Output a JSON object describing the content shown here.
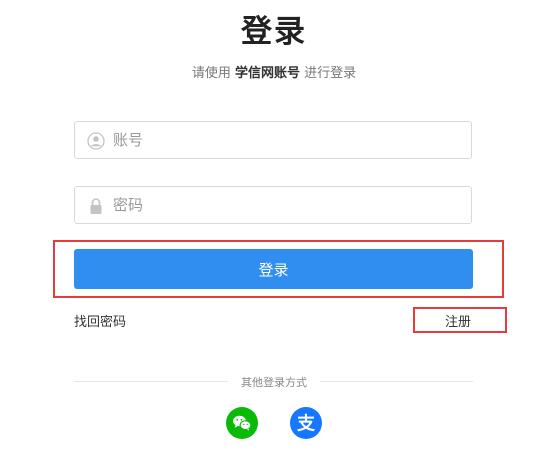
{
  "header": {
    "title": "登录",
    "subtitle_prefix": "请使用",
    "subtitle_strong": "学信网账号",
    "subtitle_suffix": "进行登录"
  },
  "form": {
    "username_placeholder": "账号",
    "password_placeholder": "密码",
    "login_label": "登录"
  },
  "links": {
    "forgot": "找回密码",
    "register": "注册"
  },
  "other_login": {
    "label": "其他登录方式",
    "methods": [
      {
        "name": "wechat",
        "icon": "wechat-icon",
        "color": "#09bb07"
      },
      {
        "name": "alipay",
        "icon": "alipay-icon",
        "color": "#1677ff",
        "glyph": "支"
      }
    ]
  },
  "colors": {
    "primary": "#2f8ef0",
    "highlight": "#e43b3b"
  }
}
